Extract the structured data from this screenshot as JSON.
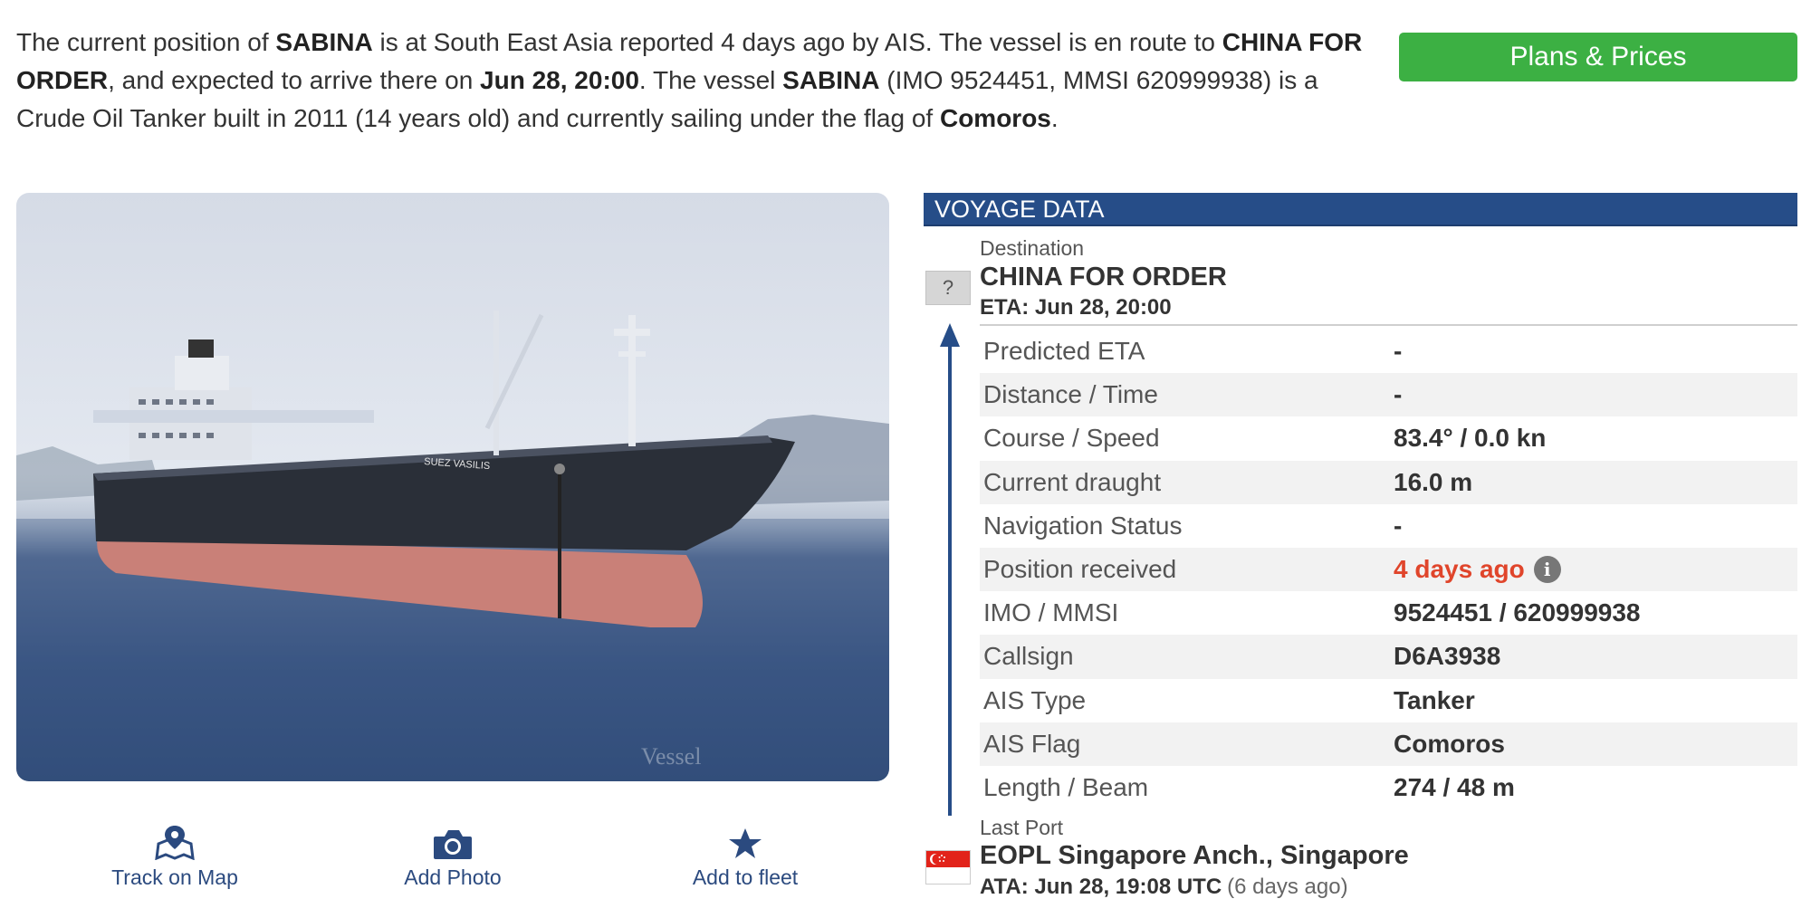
{
  "intro": {
    "p1": "The current position of ",
    "vessel_name": "SABINA",
    "p2": " is at South East Asia reported 4 days ago by AIS. The vessel is en route to ",
    "destination": "CHINA FOR ORDER",
    "p3": ", and expected to arrive there on ",
    "eta": "Jun 28, 20:00",
    "p4": ". The vessel ",
    "vessel_name2": "SABINA",
    "p5": " (IMO 9524451, MMSI 620999938) is a Crude Oil Tanker built in 2011 (14 years old) and currently sailing under the flag of ",
    "flag_country": "Comoros",
    "p6": "."
  },
  "plans_button": "Plans & Prices",
  "photo": {
    "hull_name": "SUEZ VASILIS",
    "watermark": "Vessel"
  },
  "actions": {
    "track": "Track on Map",
    "add_photo": "Add Photo",
    "add_fleet": "Add to fleet"
  },
  "voyage": {
    "header": "VOYAGE DATA",
    "dest_label": "Destination",
    "dest_name": "CHINA FOR ORDER",
    "dest_eta": "ETA: Jun 28, 20:00",
    "unknown_flag": "?",
    "rows": [
      {
        "k": "Predicted ETA",
        "v": "-"
      },
      {
        "k": "Distance / Time",
        "v": "-"
      },
      {
        "k": "Course / Speed",
        "v": "83.4° / 0.0 kn"
      },
      {
        "k": "Current draught",
        "v": "16.0 m"
      },
      {
        "k": "Navigation Status",
        "v": "-"
      },
      {
        "k": "Position received",
        "v": "4 days ago"
      },
      {
        "k": "IMO / MMSI",
        "v": "9524451 / 620999938"
      },
      {
        "k": "Callsign",
        "v": "D6A3938"
      },
      {
        "k": "AIS Type",
        "v": "Tanker"
      },
      {
        "k": "AIS Flag",
        "v": "Comoros"
      },
      {
        "k": "Length / Beam",
        "v": "274 / 48 m"
      }
    ],
    "info_glyph": "i",
    "last_port_label": "Last Port",
    "last_port_name": "EOPL Singapore Anch., Singapore",
    "last_port_ata": "ATA: Jun 28, 19:08 UTC",
    "last_port_rel": "(6 days ago)"
  },
  "colors": {
    "accent": "#264d88",
    "button_green": "#3cb043",
    "alert": "#e0452b"
  },
  "icons": [
    "map-pin-icon",
    "camera-icon",
    "star-icon",
    "info-icon",
    "singapore-flag-icon",
    "up-arrow-icon"
  ]
}
